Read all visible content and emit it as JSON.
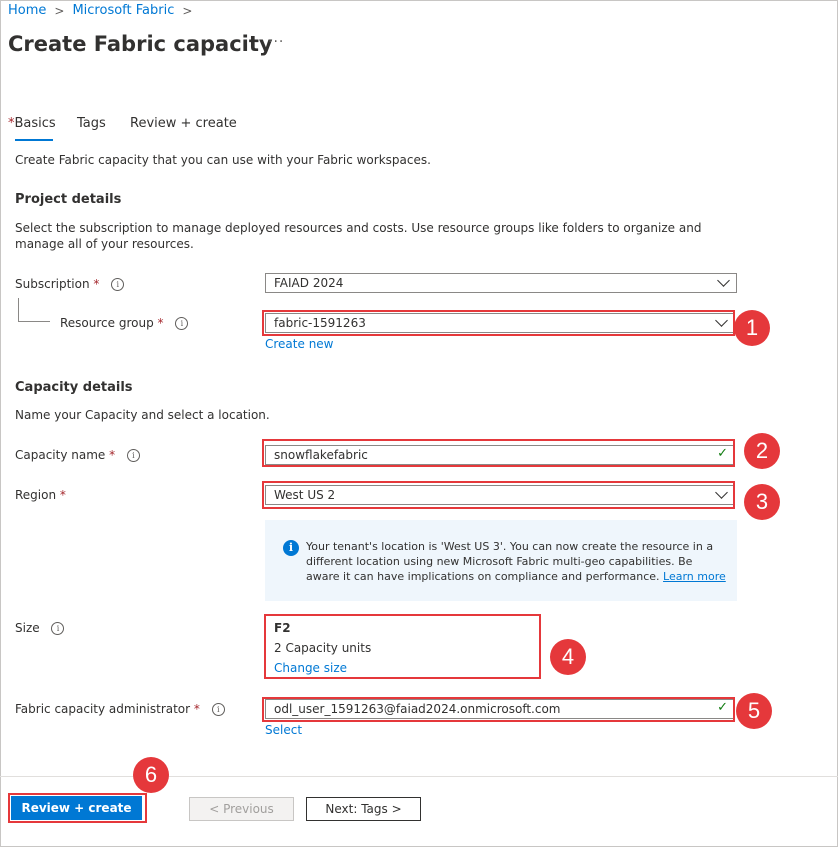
{
  "breadcrumb": {
    "home": "Home",
    "parent": "Microsoft Fabric",
    "sep": ">"
  },
  "page": {
    "title": "Create Fabric capacity",
    "more": "···"
  },
  "tabs": [
    {
      "label": "Basics",
      "required_mark": "*",
      "active": true
    },
    {
      "label": "Tags"
    },
    {
      "label": "Review + create"
    }
  ],
  "intro": "Create Fabric capacity that you can use with your Fabric workspaces.",
  "project": {
    "heading": "Project details",
    "description": "Select the subscription to manage deployed resources and costs. Use resource groups like folders to organize and manage all of your resources.",
    "subscription": {
      "label": "Subscription",
      "value": "FAIAD 2024"
    },
    "resource_group": {
      "label": "Resource group",
      "value": "fabric-1591263",
      "create_new": "Create new"
    }
  },
  "capacity": {
    "heading": "Capacity details",
    "description": "Name your Capacity and select a location.",
    "name": {
      "label": "Capacity name",
      "value": "snowflakefabric"
    },
    "region": {
      "label": "Region",
      "value": "West US 2"
    },
    "info": {
      "text": "Your tenant's location is 'West US 3'. You can now create the resource in a different location using new Microsoft Fabric multi-geo capabilities. Be aware it can have implications on compliance and performance.",
      "link": "Learn more"
    },
    "size": {
      "label": "Size",
      "sku": "F2",
      "units": "2 Capacity units",
      "change": "Change size"
    },
    "admin": {
      "label": "Fabric capacity administrator",
      "value": "odl_user_1591263@faiad2024.onmicrosoft.com",
      "select": "Select"
    }
  },
  "required_mark": "*",
  "footer": {
    "review": "Review + create",
    "previous": "< Previous",
    "next": "Next: Tags >"
  },
  "badges": [
    "1",
    "2",
    "3",
    "4",
    "5",
    "6"
  ],
  "colors": {
    "accent": "#0078d4",
    "highlight": "#e5383b",
    "valid": "#107c10"
  }
}
